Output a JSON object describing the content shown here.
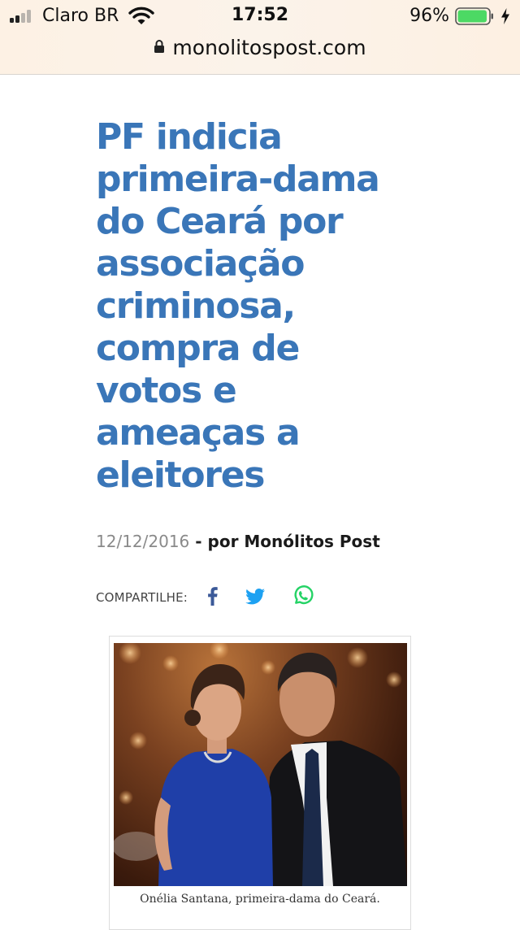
{
  "status_bar": {
    "carrier": "Claro BR",
    "time": "17:52",
    "battery_percent": "96%",
    "battery_level": 0.96,
    "signal_bars": 2,
    "icons": [
      "signal-icon",
      "wifi-icon",
      "battery-icon",
      "charging-bolt-icon"
    ]
  },
  "browser": {
    "url": "monolitospost.com",
    "icons": [
      "lock-icon"
    ]
  },
  "article": {
    "title": "PF indicia primeira-dama do Ceará por associação criminosa, compra de votos e ameaças a eleitores",
    "date": "12/12/2016",
    "separator": " - ",
    "byline": "por Monólitos Post",
    "share_label": "COMPARTILHE:",
    "share_buttons": [
      {
        "name": "facebook-icon",
        "color": "#3b5998"
      },
      {
        "name": "twitter-icon",
        "color": "#1da1f2"
      },
      {
        "name": "whatsapp-icon",
        "color": "#25d366"
      }
    ],
    "image_caption": "Onélia Santana, primeira-dama do Ceará."
  },
  "colors": {
    "headline": "#3a76b8",
    "chrome_background": "#fdf1e4",
    "battery_fill": "#4cd964"
  }
}
